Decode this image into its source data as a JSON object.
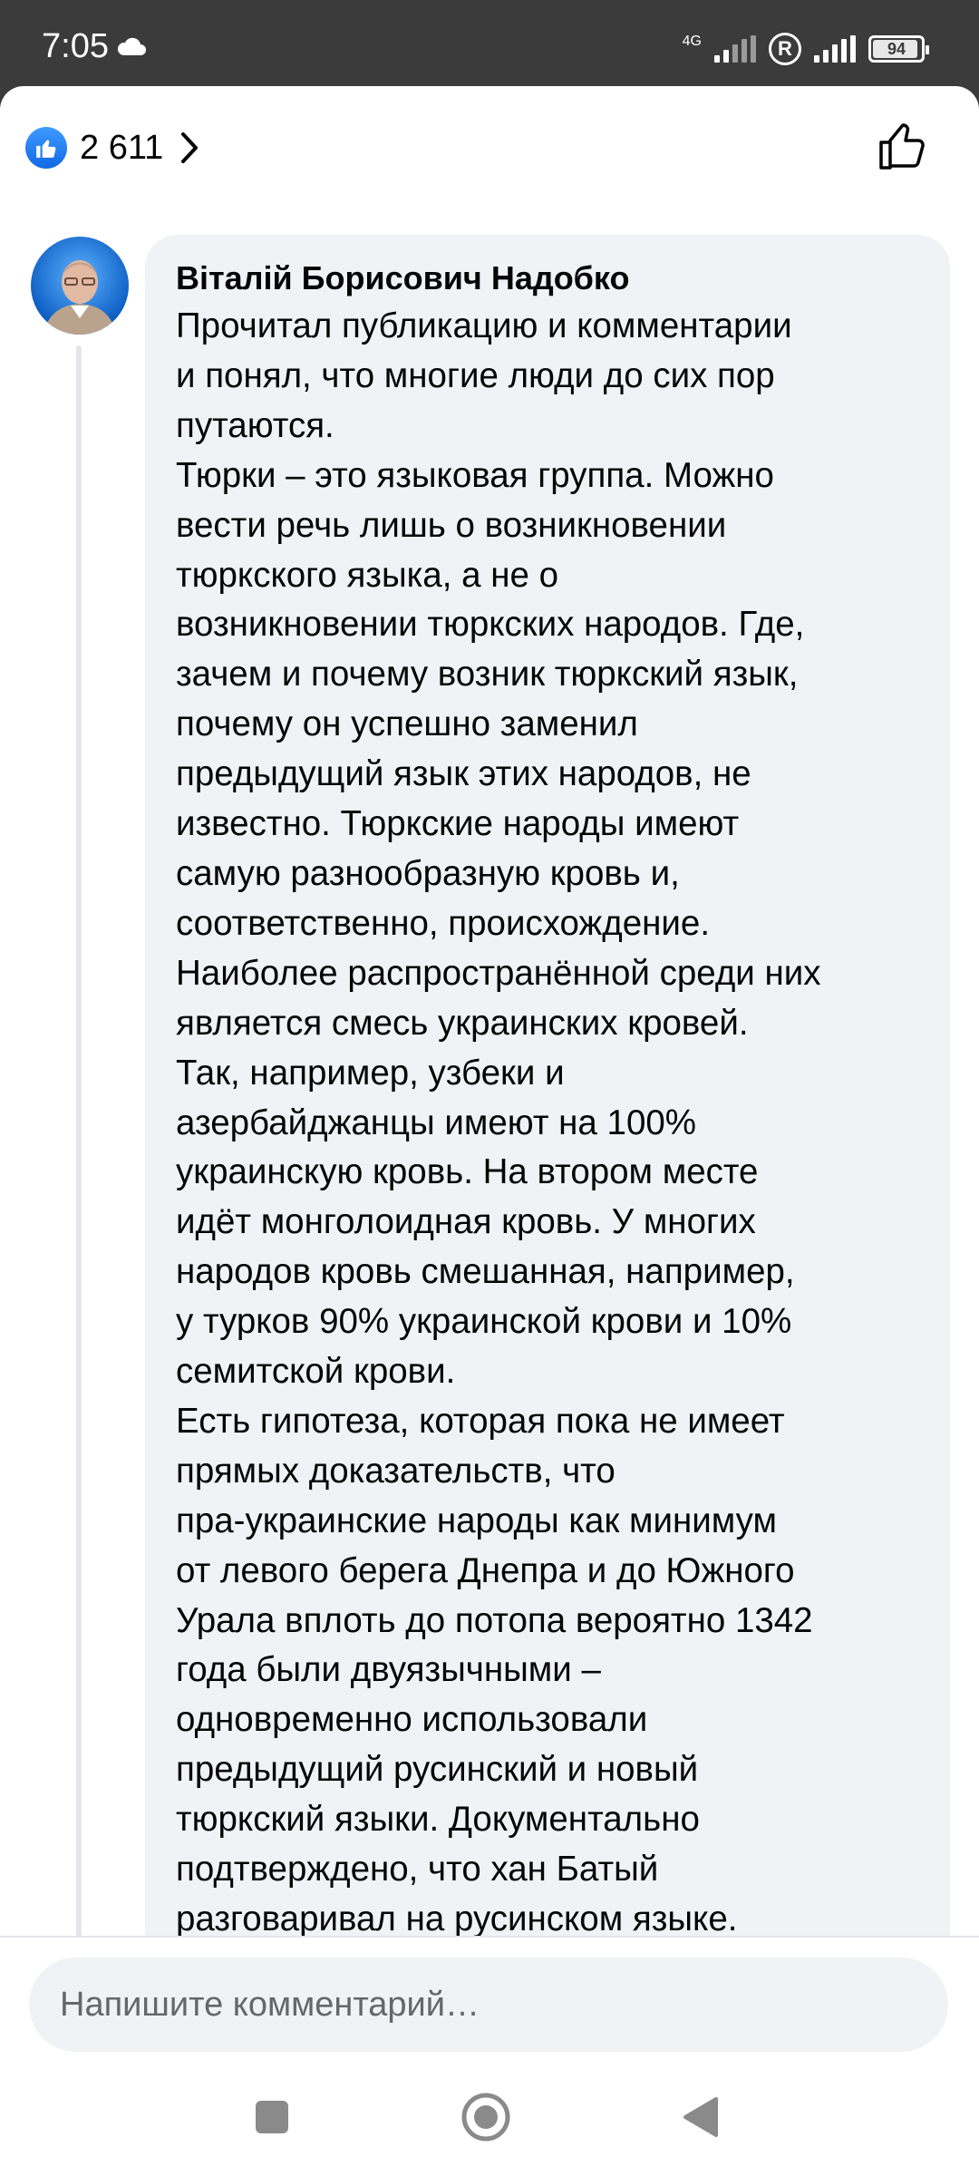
{
  "status_bar": {
    "time": "7:05",
    "network_label": "4G",
    "battery": "94",
    "battery_level": 0.94
  },
  "reactions": {
    "count": "2 611"
  },
  "comment": {
    "author": "Віталій Борисович Надобко",
    "lines": [
      "Прочитал публикацию и комментарии",
      "и понял, что многие люди до сих пор",
      "путаются.",
      "Тюрки – это языковая группа. Можно",
      "вести речь лишь о возникновении",
      "тюркского языка, а не о",
      "возникновении тюркских народов. Где,",
      "зачем и почему возник тюркский язык,",
      "почему он успешно заменил",
      "предыдущий язык этих народов, не",
      "известно. Тюркские народы имеют",
      "самую разнообразную кровь и,",
      "соответственно, происхождение.",
      "Наиболее распространённой среди них",
      "является смесь украинских кровей.",
      "Так, например, узбеки и",
      "азербайджанцы имеют на 100%",
      "украинскую кровь. На втором месте",
      "идёт монголоидная кровь. У многих",
      "народов кровь смешанная, например,",
      "у турков 90% украинской крови и 10%",
      "семитской крови.",
      "Есть гипотеза, которая пока не имеет",
      "прямых доказательств, что",
      "пра-украинские народы как минимум",
      "от левого берега Днепра и до Южного",
      "Урала вплоть до потопа вероятно 1342",
      "года были двуязычными –",
      "одновременно использовали",
      "предыдущий русинский и новый",
      "тюркский языки. Документально",
      "подтверждено, что хан Батый",
      "разговаривал на русинском языке."
    ]
  },
  "composer": {
    "placeholder": "Напишите комментарий…"
  },
  "colors": {
    "accent": "#1877f2",
    "bubble": "#f0f2f5",
    "status_bar": "#3b3b3b"
  }
}
